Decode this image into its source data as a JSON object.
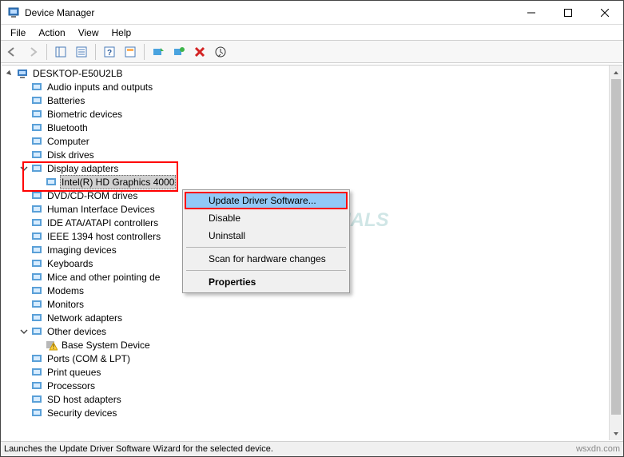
{
  "window": {
    "title": "Device Manager"
  },
  "menubar": {
    "items": [
      "File",
      "Action",
      "View",
      "Help"
    ]
  },
  "tree": {
    "root": "DESKTOP-E50U2LB",
    "nodes": [
      {
        "label": "Audio inputs and outputs"
      },
      {
        "label": "Batteries"
      },
      {
        "label": "Biometric devices"
      },
      {
        "label": "Bluetooth"
      },
      {
        "label": "Computer"
      },
      {
        "label": "Disk drives"
      },
      {
        "label": "Display adapters",
        "expanded": true,
        "children": [
          {
            "label": "Intel(R) HD Graphics 4000",
            "selected": true
          }
        ]
      },
      {
        "label": "DVD/CD-ROM drives"
      },
      {
        "label": "Human Interface Devices"
      },
      {
        "label": "IDE ATA/ATAPI controllers"
      },
      {
        "label": "IEEE 1394 host controllers"
      },
      {
        "label": "Imaging devices"
      },
      {
        "label": "Keyboards"
      },
      {
        "label": "Mice and other pointing de"
      },
      {
        "label": "Modems"
      },
      {
        "label": "Monitors"
      },
      {
        "label": "Network adapters"
      },
      {
        "label": "Other devices",
        "expanded": true,
        "children": [
          {
            "label": "Base System Device",
            "warn": true
          }
        ]
      },
      {
        "label": "Ports (COM & LPT)"
      },
      {
        "label": "Print queues"
      },
      {
        "label": "Processors"
      },
      {
        "label": "SD host adapters"
      },
      {
        "label": "Security devices"
      }
    ]
  },
  "context_menu": {
    "items": [
      {
        "label": "Update Driver Software...",
        "hover": true
      },
      {
        "label": "Disable"
      },
      {
        "label": "Uninstall"
      },
      {
        "sep": true
      },
      {
        "label": "Scan for hardware changes"
      },
      {
        "sep": true
      },
      {
        "label": "Properties",
        "bold": true
      }
    ]
  },
  "statusbar": {
    "text": "Launches the Update Driver Software Wizard for the selected device.",
    "right": "wsxdn.com"
  },
  "watermark": "APPUALS"
}
